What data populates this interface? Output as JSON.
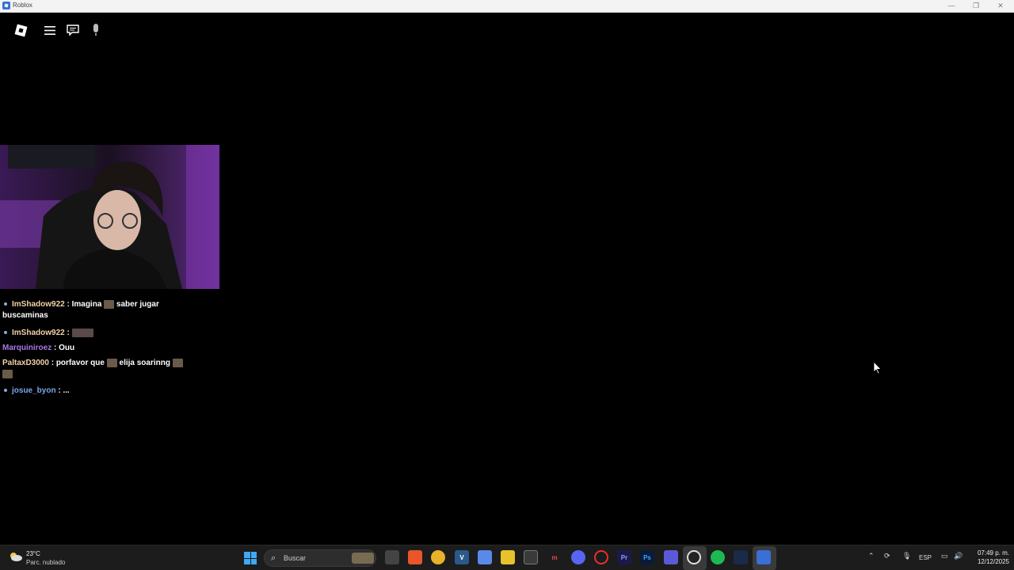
{
  "window": {
    "title": "Roblox",
    "controls": [
      "—",
      "❐",
      "✕"
    ]
  },
  "chat": {
    "messages": [
      {
        "user": "ImShadow922",
        "user_color": "#f2d2a8",
        "text1": " : Imagina ",
        "text2": " saber jugar",
        "text3": "buscaminas"
      },
      {
        "user": "ImShadow922",
        "user_color": "#f2d2a8",
        "text1": " : "
      },
      {
        "user": "Marquiniroez",
        "user_color": "#a878e8",
        "text1": " : Ouu"
      },
      {
        "user": "PaltaxD3000",
        "user_color": "#f2d2a8",
        "text1": " : porfavor que ",
        "text2": " elija soarinng "
      },
      {
        "user": "josue_byon",
        "user_color": "#7aa8e8",
        "text1": " : ..."
      }
    ]
  },
  "taskbar": {
    "weather": {
      "temp": "23°C",
      "desc": "Parc. nublado"
    },
    "search_label": "Buscar",
    "language": "ESP",
    "time": "07:49 p. m.",
    "date": "12/12/2025",
    "accent": "#3fa9f5"
  }
}
